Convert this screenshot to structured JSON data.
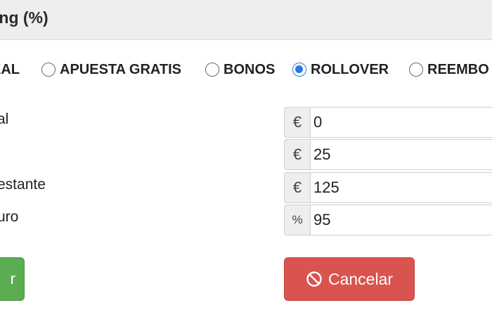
{
  "header": {
    "title": "ing (%)"
  },
  "bet_types": [
    {
      "label": "EAL",
      "checked": false
    },
    {
      "label": "APUESTA GRATIS",
      "checked": false
    },
    {
      "label": "BONOS",
      "checked": false
    },
    {
      "label": "ROLLOVER",
      "checked": true
    },
    {
      "label": "REEMBO",
      "checked": false
    }
  ],
  "fields": [
    {
      "label": "al",
      "addon": "€",
      "value": "0"
    },
    {
      "label": "",
      "addon": "€",
      "value": "25"
    },
    {
      "label": "estante",
      "addon": "€",
      "value": "125"
    },
    {
      "label": "uro",
      "addon": "%",
      "value": "95"
    }
  ],
  "buttons": {
    "submit_label": "r",
    "cancel_label": "Cancelar"
  },
  "colors": {
    "accent": "#2a7ae2",
    "success": "#5cad52",
    "danger": "#d9534f"
  }
}
